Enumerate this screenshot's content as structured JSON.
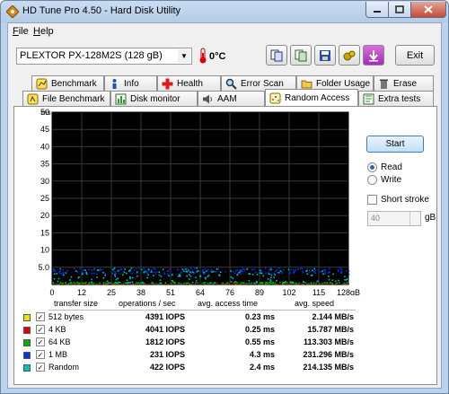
{
  "window": {
    "title": "HD Tune Pro 4.50 - Hard Disk Utility"
  },
  "menu": {
    "file": "File",
    "help": "Help"
  },
  "drive": {
    "selected": "PLEXTOR  PX-128M2S (128 gB)",
    "temperature": "0°C"
  },
  "toolbar": {
    "buttons": [
      "copy-info-icon",
      "copy-screenshot-icon",
      "save-icon",
      "options-icon",
      "download-icon"
    ],
    "exit_label": "Exit"
  },
  "tabs_row1": [
    "Benchmark",
    "Info",
    "Health",
    "Error Scan",
    "Folder Usage",
    "Erase"
  ],
  "tabs_row2": [
    "File Benchmark",
    "Disk monitor",
    "AAM",
    "Random Access",
    "Extra tests"
  ],
  "active_tab": "Random Access",
  "controls": {
    "start_label": "Start",
    "read_label": "Read",
    "write_label": "Write",
    "mode_selected": "Read",
    "short_stroke_label": "Short stroke",
    "short_stroke_checked": false,
    "short_stroke_value": "40",
    "short_stroke_unit": "gB"
  },
  "chart_data": {
    "type": "scatter",
    "ylabel": "ms",
    "xunit": "gB",
    "yticks": [
      "50",
      "45",
      "40",
      "35",
      "30",
      "25",
      "20",
      "15",
      "10",
      "5.0"
    ],
    "xticks": [
      "0",
      "12",
      "25",
      "38",
      "51",
      "64",
      "76",
      "89",
      "102",
      "115",
      "128gB"
    ],
    "xlim": [
      0,
      128
    ],
    "ylim": [
      0,
      50
    ],
    "grid": true,
    "series": [
      {
        "name": "512 bytes",
        "color": "#e6e600",
        "y_mean": 0.23
      },
      {
        "name": "4 KB",
        "color": "#e00000",
        "y_mean": 0.25
      },
      {
        "name": "64 KB",
        "color": "#00b000",
        "y_mean": 0.55
      },
      {
        "name": "1 MB",
        "color": "#1030e0",
        "y_mean": 4.3
      },
      {
        "name": "Random",
        "color": "#00c0c0",
        "y_mean": 2.4
      }
    ]
  },
  "results": {
    "headers": [
      "transfer size",
      "operations / sec",
      "avg. access time",
      "avg. speed"
    ],
    "rows": [
      {
        "size": "512 bytes",
        "ops": "4391 IOPS",
        "access": "0.23 ms",
        "speed": "2.144 MB/s",
        "color": "#e6e600"
      },
      {
        "size": "4 KB",
        "ops": "4041 IOPS",
        "access": "0.25 ms",
        "speed": "15.787 MB/s",
        "color": "#e00000"
      },
      {
        "size": "64 KB",
        "ops": "1812 IOPS",
        "access": "0.55 ms",
        "speed": "113.303 MB/s",
        "color": "#00b000"
      },
      {
        "size": "1 MB",
        "ops": "231 IOPS",
        "access": "4.3 ms",
        "speed": "231.296 MB/s",
        "color": "#1030e0"
      },
      {
        "size": "Random",
        "ops": "422 IOPS",
        "access": "2.4 ms",
        "speed": "214.135 MB/s",
        "color": "#00c0c0"
      }
    ]
  }
}
